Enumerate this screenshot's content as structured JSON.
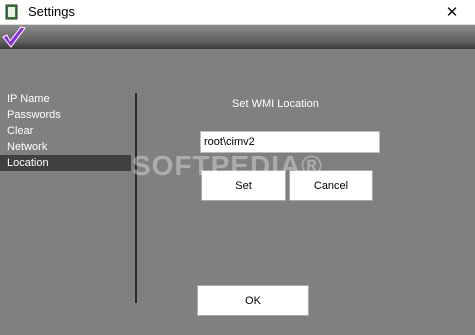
{
  "window": {
    "title": "Settings",
    "close_glyph": "✕",
    "icon": "app-document-icon"
  },
  "banner": {
    "logo": "purple-check-logo"
  },
  "nav": {
    "items": [
      {
        "label": "IP Name"
      },
      {
        "label": "Passwords"
      },
      {
        "label": "Clear"
      },
      {
        "label": "Network"
      },
      {
        "label": "Location"
      }
    ],
    "selected": "Location"
  },
  "location_panel": {
    "heading": "Set WMI Location",
    "input_value": "root\\cimv2",
    "set_label": "Set",
    "cancel_label": "Cancel"
  },
  "ok_label": "OK",
  "watermark": "SOFTPEDIA®",
  "colors": {
    "background": "#808080",
    "selected_item": "#404040",
    "logo_purple": "#8a2be2"
  }
}
